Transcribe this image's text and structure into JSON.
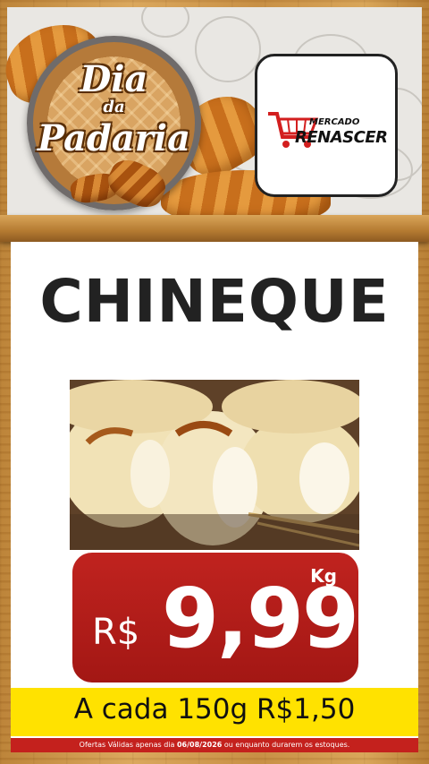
{
  "header": {
    "badge": {
      "line1": "Dia",
      "line2": "da",
      "line3": "Padaria"
    },
    "logo": {
      "small": "MERCADO",
      "big": "RENASCER",
      "icon": "shopping-cart-icon"
    }
  },
  "product": {
    "name": "CHINEQUE",
    "image": "cuca-bread-photo",
    "unit": "Kg",
    "currency": "R$",
    "price": "9,99",
    "portion_note": "A cada 150g R$1,50"
  },
  "footer": {
    "pre": "Ofertas Válidas apenas dia",
    "date": "06/08/2026",
    "post": "ou enquanto durarem os estoques."
  },
  "colors": {
    "price_red": "#c0231f",
    "strip_yellow": "#ffe200",
    "footer_red": "#c4211d"
  }
}
